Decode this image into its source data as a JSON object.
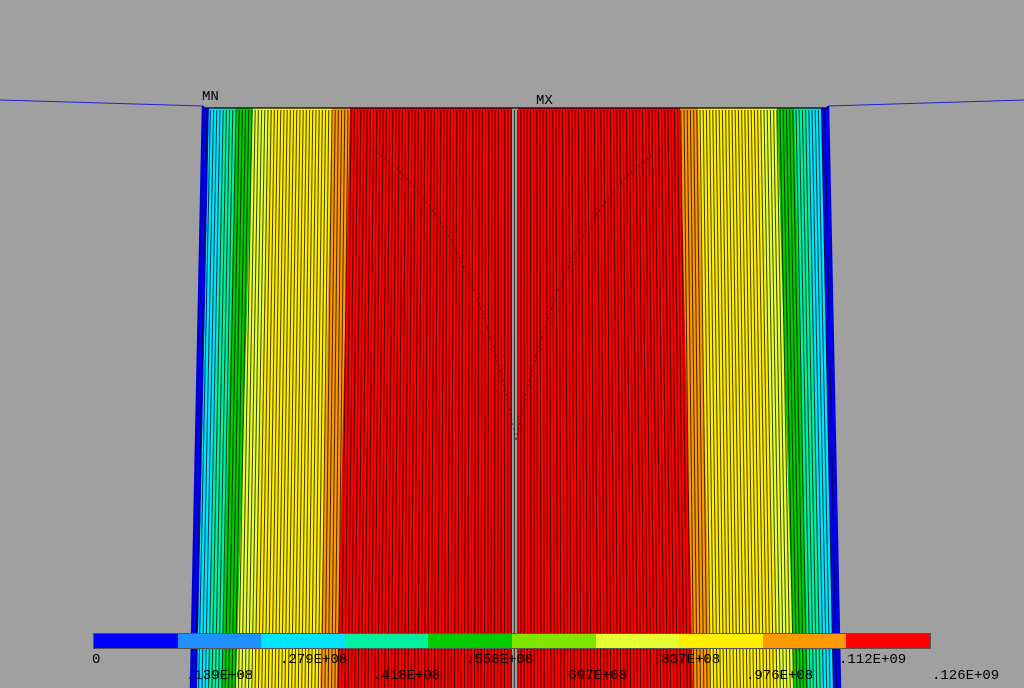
{
  "plot": {
    "background": "#a0a0a0",
    "boundary_color": "#2222cc",
    "mesh_line_color": "#000000",
    "min_marker": "MN",
    "max_marker": "MX"
  },
  "legend": {
    "colors": [
      "#0000ff",
      "#1e90ff",
      "#00e5ff",
      "#00f0a0",
      "#00cc00",
      "#7fe600",
      "#e6ff33",
      "#ffee00",
      "#ff9900",
      "#ff0000"
    ],
    "labels": [
      "0",
      ".139E+08",
      ".279E+08",
      ".418E+08",
      ".558E+08",
      ".697E+08",
      ".837E+08",
      ".976E+08",
      ".112E+09",
      ".126E+09"
    ]
  },
  "chart_data": {
    "type": "heatmap",
    "description_values": {
      "min": 0,
      "max": 126000000,
      "levels": [
        0,
        13900000,
        27900000,
        41800000,
        55800000,
        69700000,
        83700000,
        97600000,
        112000000,
        126000000
      ]
    }
  }
}
